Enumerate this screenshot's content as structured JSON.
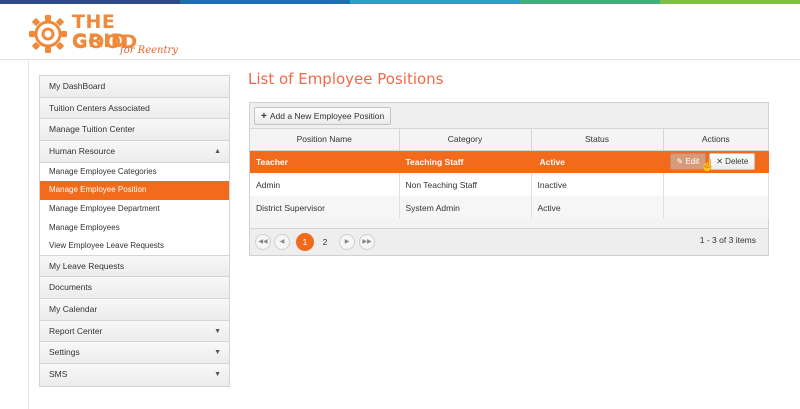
{
  "colors": {
    "accent": "#f26b1d",
    "title": "#ef6a4a"
  },
  "topbar": {
    "segments": [
      "#2b4a8a",
      "#1f6fb0",
      "#28a0c8",
      "#3bb37a",
      "#7bc043"
    ]
  },
  "logo": {
    "line1": "THE GOOD",
    "line2": "GRID",
    "tagline": "for Reentry"
  },
  "sidebar": {
    "items": [
      {
        "label": "My DashBoard"
      },
      {
        "label": "Tuition Centers Associated"
      },
      {
        "label": "Manage Tuition Center"
      },
      {
        "label": "Human Resource",
        "caret": "▲"
      }
    ],
    "sub_items": [
      {
        "label": "Manage Employee Categories"
      },
      {
        "label": "Manage Employee Position"
      },
      {
        "label": "Manage Employee Department"
      },
      {
        "label": "Manage Employees"
      },
      {
        "label": "View Employee Leave Requests"
      }
    ],
    "items_after": [
      {
        "label": "My Leave Requests"
      },
      {
        "label": "Documents"
      },
      {
        "label": "My Calendar"
      },
      {
        "label": "Report Center",
        "caret": "▼"
      },
      {
        "label": "Settings",
        "caret": "▼"
      },
      {
        "label": "SMS",
        "caret": "▼"
      }
    ]
  },
  "main": {
    "title": "List of Employee Positions",
    "add_button": "Add a New Employee Position",
    "columns": [
      "Position Name",
      "Category",
      "Status",
      "Actions"
    ],
    "rows": [
      {
        "name": "Teacher",
        "category": "Teaching Staff",
        "status": "Active"
      },
      {
        "name": "Admin",
        "category": "Non Teaching Staff",
        "status": "Inactive"
      },
      {
        "name": "District Supervisor",
        "category": "System Admin",
        "status": "Active"
      }
    ],
    "edit_label": "Edit",
    "delete_label": "Delete",
    "pager": {
      "pages": [
        "1",
        "2"
      ],
      "current": "1",
      "info": "1 - 3 of 3 items"
    }
  }
}
